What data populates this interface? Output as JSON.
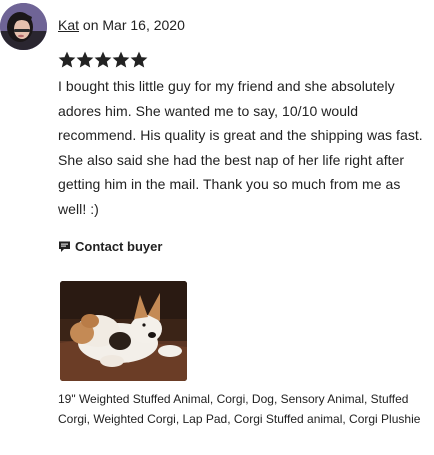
{
  "reviewer": {
    "name": "Kat",
    "date_text": "on Mar 16, 2020",
    "avatar_icon": "reviewer-avatar-photo"
  },
  "rating": {
    "value": 5,
    "max": 5,
    "star_color": "#222222"
  },
  "review": {
    "text": "I bought this little guy for my friend and she absolutely adores him. She wanted me to say, 10/10 would recommend. His quality is great and the shipping was fast. She also said she had the best nap of her life right after getting him in the mail. Thank you so much from me as well! :)"
  },
  "contact": {
    "label": "Contact buyer",
    "icon": "message-icon"
  },
  "product": {
    "title": "19\" Weighted Stuffed Animal, Corgi, Dog, Sensory Animal, Stuffed Corgi, Weighted Corgi, Lap Pad, Corgi Stuffed animal, Corgi Plushie",
    "photo_icon": "corgi-plush-photo"
  }
}
